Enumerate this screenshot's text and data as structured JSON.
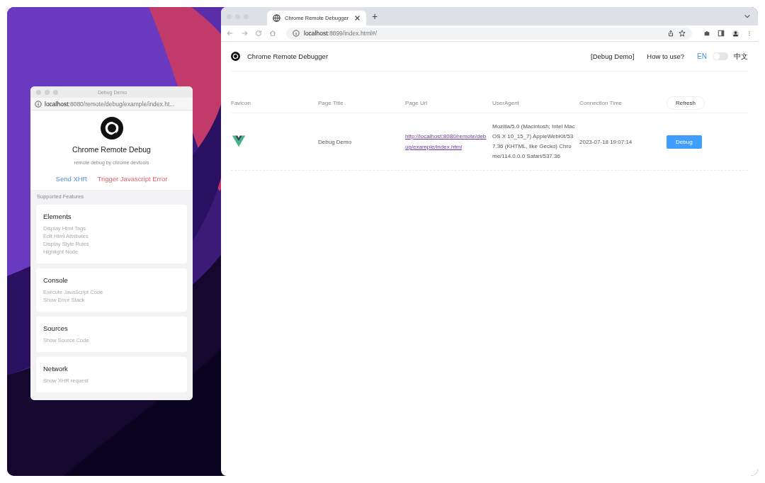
{
  "debug_window": {
    "title": "Debug Demo",
    "url_host": "localhost",
    "url_rest": ":8080/remote/debug/example/index.ht...",
    "app_title": "Chrome Remote Debug",
    "subtitle": "remote debug by chrome devtools",
    "actions": [
      {
        "label": "Send XHR",
        "kind": "info"
      },
      {
        "label": "Trigger Javascript Error",
        "kind": "danger"
      }
    ],
    "features_heading": "Supported Features",
    "features": [
      {
        "title": "Elements",
        "items": [
          "Display Html Tags",
          "Edit Html Attributes",
          "Display Style Rules",
          "Highlight Node"
        ]
      },
      {
        "title": "Console",
        "items": [
          "Execute JavaScript Code",
          "Show Error Stack"
        ]
      },
      {
        "title": "Sources",
        "items": [
          "Show Source Code"
        ]
      },
      {
        "title": "Network",
        "items": [
          "Show XHR request"
        ]
      }
    ]
  },
  "browser": {
    "tab_title": "Chrome Remote Debugger",
    "new_tab": "+",
    "url_host": "localhost",
    "url_rest": ":8899/index.html#/"
  },
  "app": {
    "title": "Chrome Remote Debugger",
    "nav": [
      "[Debug Demo]",
      "How to use?"
    ],
    "language": {
      "left": "EN",
      "right": "中文",
      "on": false
    }
  },
  "table": {
    "columns": [
      "Favicon",
      "Page Title",
      "Page Url",
      "UserAgent",
      "Connection Time"
    ],
    "refresh": "Refresh",
    "rows": [
      {
        "page_title": "Debug Demo",
        "page_url": "http://localhost:8080/remote/debug/example/index.html",
        "user_agent": "Mozilla/5.0 (Macintosh; Intel Mac OS X 10_15_7) AppleWebKit/537.36 (KHTML, like Gecko) Chrome/114.0.0.0 Safari/537.36",
        "connection_time": "2023-07-18 19:07:14",
        "action": "Debug"
      }
    ]
  }
}
